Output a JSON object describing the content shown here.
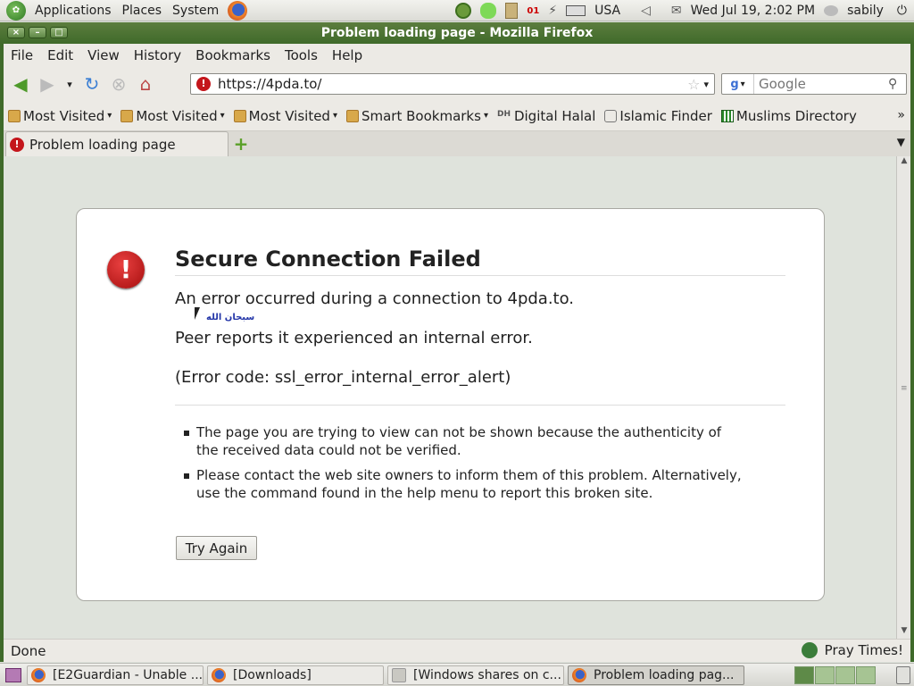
{
  "top_panel": {
    "menus": [
      "Applications",
      "Places",
      "System"
    ],
    "keyboard_layout": "USA",
    "datetime": "Wed Jul 19,  2:02 PM",
    "user": "sabily",
    "icons": [
      "gnome-logo-icon",
      "firefox-icon",
      "pidgin-icon",
      "chat-icon",
      "clipboard-icon",
      "network-icon",
      "keyboard-icon",
      "volume-icon",
      "mail-icon",
      "power-icon"
    ],
    "clock_badge": "01"
  },
  "window": {
    "title": "Problem loading page - Mozilla Firefox",
    "controls": [
      "×",
      "–",
      "□"
    ]
  },
  "menubar": {
    "items": [
      {
        "label": "File"
      },
      {
        "label": "Edit"
      },
      {
        "label": "View"
      },
      {
        "label": "History"
      },
      {
        "label": "Bookmarks"
      },
      {
        "label": "Tools"
      },
      {
        "label": "Help"
      }
    ]
  },
  "navbar": {
    "url": "https://4pda.to/",
    "search_placeholder": "Google",
    "search_engine_label": "g"
  },
  "bookmarks": {
    "items": [
      {
        "label": "Most Visited",
        "type": "folder"
      },
      {
        "label": "Most Visited",
        "type": "folder"
      },
      {
        "label": "Most Visited",
        "type": "folder"
      },
      {
        "label": "Smart Bookmarks",
        "type": "folder"
      },
      {
        "label": "Digital Halal",
        "type": "link"
      },
      {
        "label": "Islamic Finder",
        "type": "link"
      },
      {
        "label": "Muslims Directory",
        "type": "link"
      }
    ],
    "more": "»"
  },
  "tabs": {
    "items": [
      {
        "label": "Problem loading page"
      }
    ],
    "new_tab": "+"
  },
  "error_page": {
    "title": "Secure Connection Failed",
    "description": "An error occurred during a connection to 4pda.to.",
    "arabic_overlay": "سبحان الله",
    "peer_message": "Peer reports it experienced an internal error.",
    "error_code": "(Error code: ssl_error_internal_error_alert)",
    "bullets": [
      "The page you are trying to view can not be shown because the authenticity of the received data could not be verified.",
      "Please contact the web site owners to inform them of this problem. Alternatively, use the command found in the help menu to report this broken site."
    ],
    "try_again": "Try Again"
  },
  "statusbar": {
    "text": "Done",
    "pray": "Pray Times!"
  },
  "taskbar": {
    "tasks": [
      {
        "label": "[E2Guardian - Unable ...",
        "active": false,
        "icon": "firefox"
      },
      {
        "label": "[Downloads]",
        "active": false,
        "icon": "firefox"
      },
      {
        "label": "[Windows shares on c...",
        "active": false,
        "icon": "doc"
      },
      {
        "label": "Problem loading pag...",
        "active": true,
        "icon": "firefox"
      }
    ]
  },
  "colors": {
    "titlebar": "#3f6a2a",
    "error_red": "#c4161c",
    "page_bg": "#dfe3dc"
  }
}
